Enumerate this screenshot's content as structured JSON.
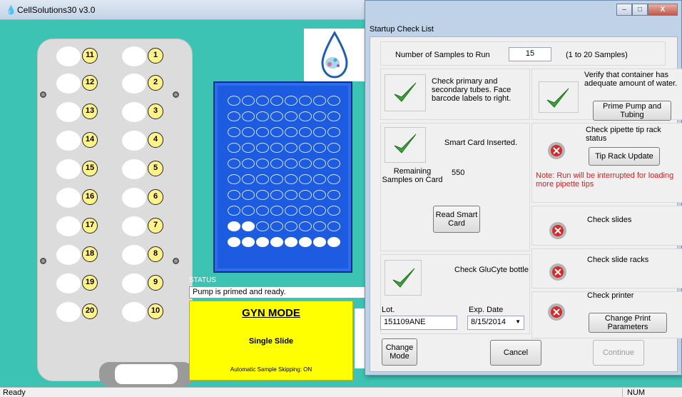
{
  "main_window": {
    "title": "CellSolutions30 v3.0",
    "icon": "droplet-icon"
  },
  "rack": {
    "right_column": [
      "1",
      "2",
      "3",
      "4",
      "5",
      "6",
      "7",
      "8",
      "9",
      "10"
    ],
    "left_column": [
      "11",
      "12",
      "13",
      "14",
      "15",
      "16",
      "17",
      "18",
      "19",
      "20"
    ]
  },
  "tray": {
    "rows": 10,
    "cols": 8,
    "filled_row_9": 2,
    "filled_row_10": 8
  },
  "status": {
    "label": "STATUS",
    "text": "Pump is primed and ready."
  },
  "mode": {
    "title": "GYN MODE",
    "subtitle": "Single Slide",
    "skip": "Automatic Sample Skipping: ON"
  },
  "statusbar": {
    "ready": "Ready",
    "num": "NUM"
  },
  "dialog": {
    "title": "Startup Check List",
    "samples_label": "Number of Samples to Run",
    "samples_value": "15",
    "samples_range": "(1 to 20 Samples)",
    "tubes_text": "Check primary and secondary tubes. Face barcode labels to right.",
    "container_text": "Verify that container has adequate amount of water.",
    "prime_button": "Prime Pump and Tubing",
    "smart_card_text": "Smart Card Inserted.",
    "remaining_label": "Remaining Samples on Card",
    "remaining_value": "550",
    "read_card_button": "Read Smart Card",
    "tip_rack_text": "Check pipette tip rack status",
    "tip_rack_button": "Tip Rack Update",
    "tip_rack_note": "Note: Run will be interrupted for loading more pipette tips",
    "slides_text": "Check slides",
    "slide_racks_text": "Check slide racks",
    "glucyte_text": "Check GluCyte bottle",
    "lot_label": "Lot.",
    "lot_value": "151109ANE",
    "exp_label": "Exp. Date",
    "exp_value": "8/15/2014",
    "printer_text": "Check printer",
    "print_params_button": "Change Print Parameters",
    "change_mode_button": "Change Mode",
    "cancel_button": "Cancel",
    "continue_button": "Continue",
    "check_color": "#3aa63a",
    "error_color": "#d42a2a"
  }
}
